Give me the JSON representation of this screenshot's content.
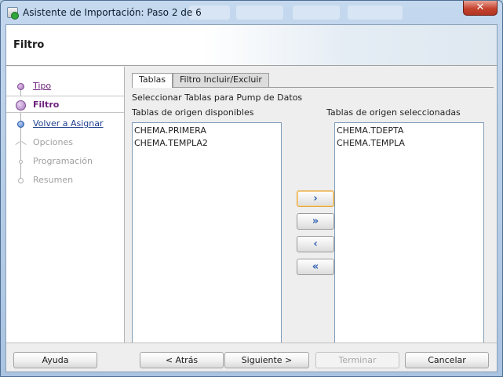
{
  "window": {
    "title": "Asistente de Importación: Paso 2 de 6",
    "close_label": "✕"
  },
  "header": {
    "title": "Filtro"
  },
  "steps": [
    {
      "label": "Tipo",
      "state": "done"
    },
    {
      "label": "Filtro",
      "state": "current"
    },
    {
      "label": "Volver a Asignar",
      "state": "link"
    },
    {
      "label": "Opciones",
      "state": "disabled"
    },
    {
      "label": "Programación",
      "state": "disabled"
    },
    {
      "label": "Resumen",
      "state": "disabled"
    }
  ],
  "tabs": [
    {
      "label": "Tablas",
      "active": true
    },
    {
      "label": "Filtro Incluir/Excluir",
      "active": false
    }
  ],
  "panel": {
    "instruction": "Seleccionar Tablas para Pump de Datos",
    "available_label": "Tablas de origen disponibles",
    "selected_label": "Tablas de origen seleccionadas",
    "available": [
      "CHEMA.PRIMERA",
      "CHEMA.TEMPLA2"
    ],
    "selected": [
      "CHEMA.TDEPTA",
      "CHEMA.TEMPLA"
    ]
  },
  "move_buttons": {
    "move_one": "›",
    "move_all": "»",
    "remove_one": "‹",
    "remove_all": "«"
  },
  "footer": {
    "help": "Ayuda",
    "back": "< Atrás",
    "next": "Siguiente >",
    "finish": "Terminar",
    "cancel": "Cancelar"
  }
}
